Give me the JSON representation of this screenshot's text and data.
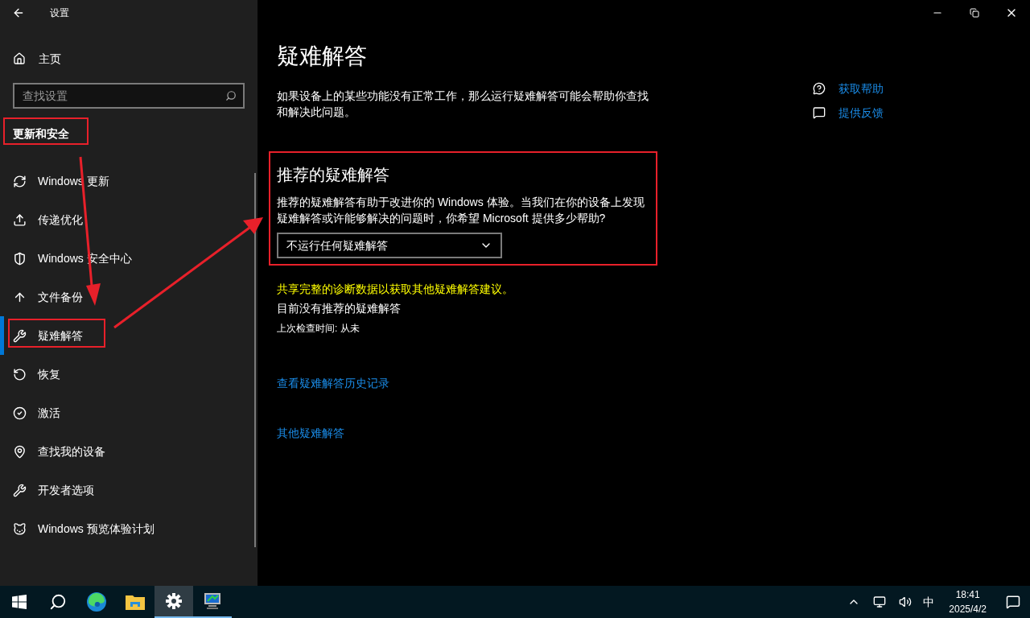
{
  "window": {
    "title": "设置"
  },
  "sidebar": {
    "home": "主页",
    "search": {
      "placeholder": "查找设置"
    },
    "section": "更新和安全",
    "items": [
      {
        "label": "Windows 更新",
        "selected": false
      },
      {
        "label": "传递优化",
        "selected": false
      },
      {
        "label": "Windows 安全中心",
        "selected": false
      },
      {
        "label": "文件备份",
        "selected": false
      },
      {
        "label": "疑难解答",
        "selected": true
      },
      {
        "label": "恢复",
        "selected": false
      },
      {
        "label": "激活",
        "selected": false
      },
      {
        "label": "查找我的设备",
        "selected": false
      },
      {
        "label": "开发者选项",
        "selected": false
      },
      {
        "label": "Windows 预览体验计划",
        "selected": false
      }
    ]
  },
  "main": {
    "title": "疑难解答",
    "intro": "如果设备上的某些功能没有正常工作，那么运行疑难解答可能会帮助你查找和解决此问题。",
    "recommended": {
      "heading": "推荐的疑难解答",
      "description": "推荐的疑难解答有助于改进你的 Windows 体验。当我们在你的设备上发现疑难解答或许能够解决的问题时，你希望 Microsoft 提供多少帮助?",
      "dropdown": {
        "value": "不运行任何疑难解答"
      }
    },
    "diagnostic_link": "共享完整的诊断数据以获取其他疑难解答建议。",
    "status": "目前没有推荐的疑难解答",
    "last_checked": "上次检查时间: 从未",
    "history_link": "查看疑难解答历史记录",
    "other_link": "其他疑难解答"
  },
  "help_links": [
    "获取帮助",
    "提供反馈"
  ],
  "taskbar": {
    "apps": [
      {
        "running": false,
        "selected": false
      },
      {
        "running": false,
        "selected": false
      },
      {
        "running": false,
        "selected": false
      },
      {
        "running": false,
        "selected": false
      },
      {
        "running": true,
        "selected": true
      },
      {
        "running": true,
        "selected": false
      }
    ],
    "ime": "中",
    "time": "18:41",
    "date": "2025/4/2"
  }
}
